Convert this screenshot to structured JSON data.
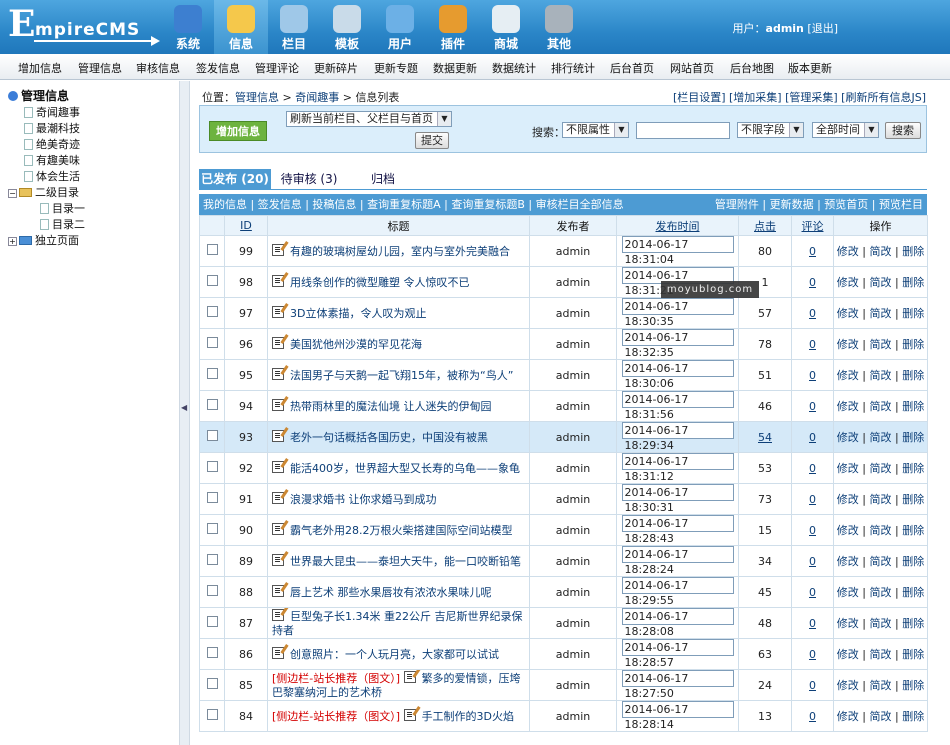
{
  "app": {
    "logo_first": "E",
    "logo_rest": "mpireCMS"
  },
  "nav": [
    {
      "label": "系统",
      "icon": "globe-icon",
      "color": "#3d7fd0"
    },
    {
      "label": "信息",
      "icon": "document-icon",
      "color": "#f5c84b",
      "active": true
    },
    {
      "label": "栏目",
      "icon": "folder-icon",
      "color": "#9fc8e8"
    },
    {
      "label": "模板",
      "icon": "template-icon",
      "color": "#c9dbe9"
    },
    {
      "label": "用户",
      "icon": "user-icon",
      "color": "#6cb0e6"
    },
    {
      "label": "插件",
      "icon": "tools-icon",
      "color": "#e69b2f"
    },
    {
      "label": "商城",
      "icon": "card-icon",
      "color": "#e6eef3"
    },
    {
      "label": "其他",
      "icon": "gear-icon",
      "color": "#a8b2bb"
    }
  ],
  "user": {
    "prefix": "用户：",
    "name": "admin",
    "logout": "[退出]"
  },
  "menu": [
    "增加信息",
    "管理信息",
    "审核信息",
    "签发信息",
    "管理评论",
    "更新碎片",
    "更新专题",
    "数据更新",
    "数据统计",
    "排行统计",
    "后台首页",
    "网站首页",
    "后台地图",
    "版本更新"
  ],
  "tree": {
    "root": "管理信息",
    "items": [
      "奇闻趣事",
      "最潮科技",
      "绝美奇迹",
      "有趣美味",
      "体会生活"
    ],
    "folder": "二级目录",
    "sub": [
      "目录一",
      "目录二"
    ],
    "pages": "独立页面"
  },
  "crumb": {
    "prefix": "位置：",
    "a": "管理信息",
    "sep": " > ",
    "b": "奇闻趣事",
    "c": "信息列表"
  },
  "quicklinks": "[栏目设置] [增加采集] [管理采集] [刷新所有信息JS]",
  "toolbar": {
    "add": "增加信息",
    "refresh_select": "刷新当前栏目、父栏目与首页",
    "submit": "提交",
    "search_label": "搜索：",
    "attr_select": "不限属性",
    "field_select": "不限字段",
    "time_select": "全部时间",
    "search_btn": "搜索"
  },
  "tabs": [
    "已发布 (20)",
    "待审核 (3)",
    "归档"
  ],
  "bar2": {
    "left": "我的信息 | 签发信息 | 投稿信息 | 查询重复标题A | 查询重复标题B | 审核栏目全部信息",
    "right": "管理附件 | 更新数据 | 预览首页 | 预览栏目"
  },
  "columns": {
    "id": "ID",
    "title": "标题",
    "publisher": "发布者",
    "time": "发布时间",
    "clicks": "点击",
    "comments": "评论",
    "ops": "操作"
  },
  "ops": {
    "edit": "修改",
    "simple": "简改",
    "delete": "删除",
    "sep": " | "
  },
  "rows": [
    {
      "id": "99",
      "cat": "",
      "title": "有趣的玻璃树屋幼儿园，室内与室外完美融合",
      "publisher": "admin",
      "time": "2014-06-17 18:31:04",
      "clicks": "80",
      "comments": "0"
    },
    {
      "id": "98",
      "cat": "",
      "title": "用线条创作的微型雕塑 令人惊叹不已",
      "publisher": "admin",
      "time": "2014-06-17 18:31:21",
      "clicks": "1",
      "comments": "0"
    },
    {
      "id": "97",
      "cat": "",
      "title": "3D立体素描，令人叹为观止",
      "publisher": "admin",
      "time": "2014-06-17 18:30:35",
      "clicks": "57",
      "comments": "0"
    },
    {
      "id": "96",
      "cat": "",
      "title": "美国犹他州沙漠的罕见花海",
      "publisher": "admin",
      "time": "2014-06-17 18:32:35",
      "clicks": "78",
      "comments": "0"
    },
    {
      "id": "95",
      "cat": "",
      "title": "法国男子与天鹅一起飞翔15年，被称为“鸟人”",
      "publisher": "admin",
      "time": "2014-06-17 18:30:06",
      "clicks": "51",
      "comments": "0"
    },
    {
      "id": "94",
      "cat": "",
      "title": "热带雨林里的魔法仙境 让人迷失的伊甸园",
      "publisher": "admin",
      "time": "2014-06-17 18:31:56",
      "clicks": "46",
      "comments": "0"
    },
    {
      "id": "93",
      "cat": "",
      "title": "老外一句话概括各国历史，中国没有被黑",
      "publisher": "admin",
      "time": "2014-06-17 18:29:34",
      "clicks": "54",
      "comments": "0",
      "highlight": true
    },
    {
      "id": "92",
      "cat": "",
      "title": "能活400岁，世界超大型又长寿的乌龟——象龟",
      "publisher": "admin",
      "time": "2014-06-17 18:31:12",
      "clicks": "53",
      "comments": "0"
    },
    {
      "id": "91",
      "cat": "",
      "title": "浪漫求婚书 让你求婚马到成功",
      "publisher": "admin",
      "time": "2014-06-17 18:30:31",
      "clicks": "73",
      "comments": "0"
    },
    {
      "id": "90",
      "cat": "",
      "title": "霸气老外用28.2万根火柴搭建国际空间站模型",
      "publisher": "admin",
      "time": "2014-06-17 18:28:43",
      "clicks": "15",
      "comments": "0"
    },
    {
      "id": "89",
      "cat": "",
      "title": "世界最大昆虫——泰坦大天牛，能一口咬断铅笔",
      "publisher": "admin",
      "time": "2014-06-17 18:28:24",
      "clicks": "34",
      "comments": "0"
    },
    {
      "id": "88",
      "cat": "",
      "title": "唇上艺术 那些水果唇妆有浓浓水果味儿呢",
      "publisher": "admin",
      "time": "2014-06-17 18:29:55",
      "clicks": "45",
      "comments": "0"
    },
    {
      "id": "87",
      "cat": "",
      "title": "巨型兔子长1.34米 重22公斤 吉尼斯世界纪录保持者",
      "publisher": "admin",
      "time": "2014-06-17 18:28:08",
      "clicks": "48",
      "comments": "0"
    },
    {
      "id": "86",
      "cat": "",
      "title": "创意照片：一个人玩月亮，大家都可以试试",
      "publisher": "admin",
      "time": "2014-06-17 18:28:57",
      "clicks": "63",
      "comments": "0"
    },
    {
      "id": "85",
      "cat": "[侧边栏-站长推荐（图文）]",
      "title": "繁多的爱情锁，压垮巴黎塞纳河上的艺术桥",
      "publisher": "admin",
      "time": "2014-06-17 18:27:50",
      "clicks": "24",
      "comments": "0"
    },
    {
      "id": "84",
      "cat": "[侧边栏-站长推荐（图文）]",
      "title": "手工制作的3D火焰",
      "publisher": "admin",
      "time": "2014-06-17 18:28:14",
      "clicks": "13",
      "comments": "0"
    }
  ],
  "watermark": "moyublog.com"
}
